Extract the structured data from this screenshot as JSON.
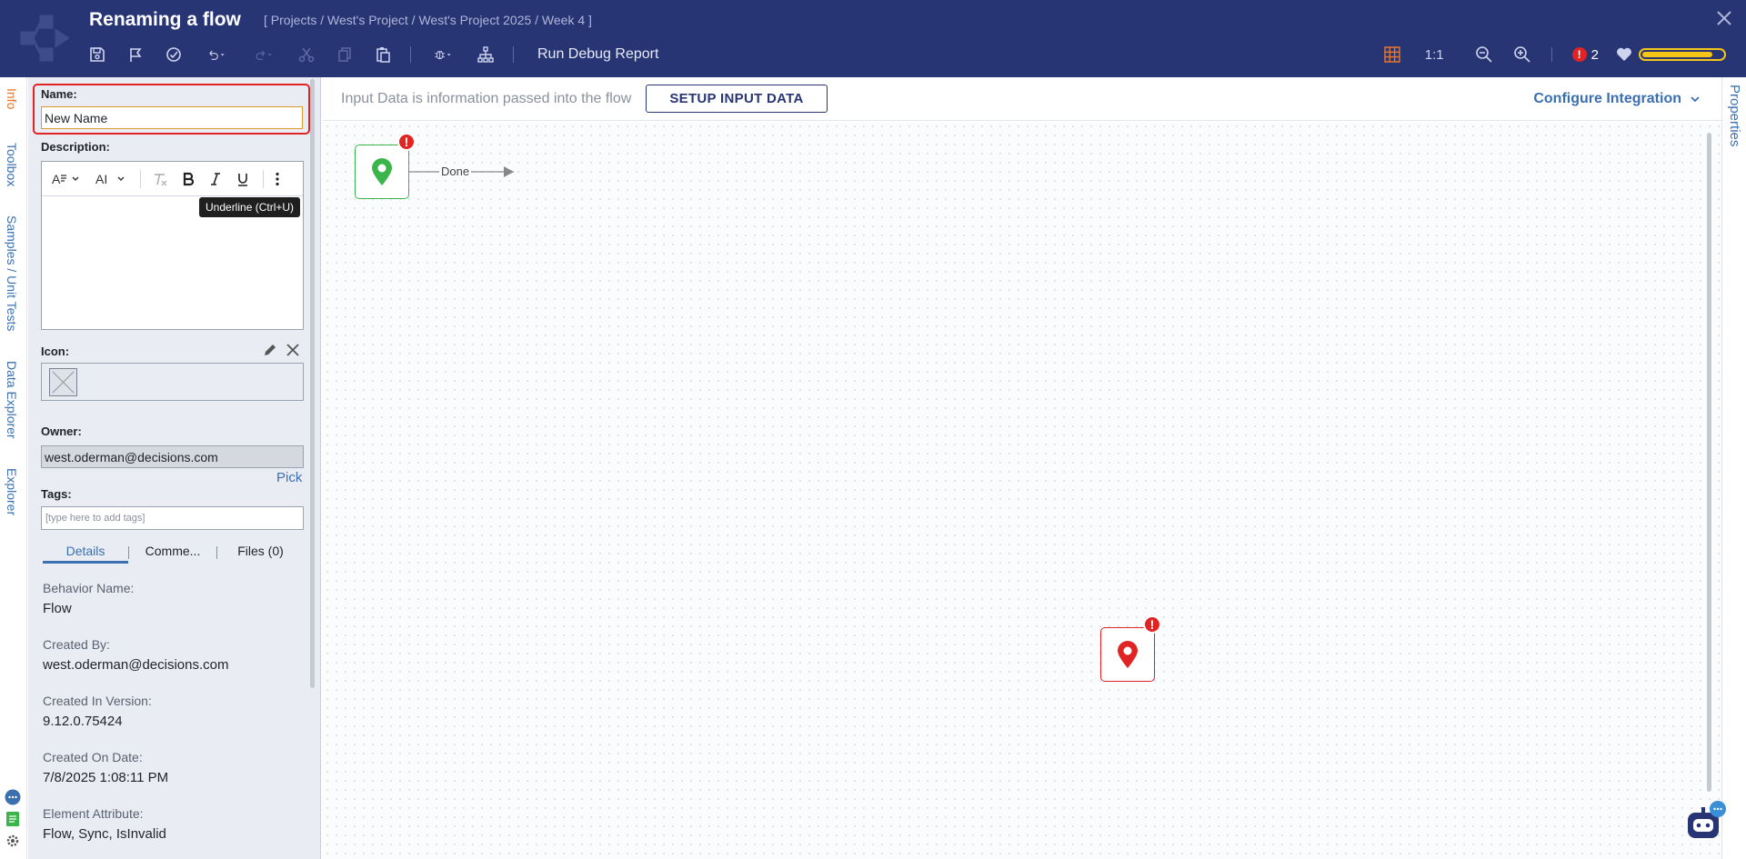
{
  "app": {
    "title": "Renaming a flow",
    "breadcrumb": "[ Projects / West's Project / West's Project 2025 / Week 4 ]"
  },
  "toolbar": {
    "run_debug_label": "Run Debug Report",
    "zoom_label": "1:1",
    "error_count": "2",
    "error_glyph": "!",
    "health_percent": 88
  },
  "left_tabs": [
    "Info",
    "Toolbox",
    "Samples / Unit Tests",
    "Data Explorer",
    "Explorer"
  ],
  "info": {
    "name_label": "Name:",
    "name_value": "New Name",
    "description_label": "Description:",
    "rte_tooltip": "Underline (Ctrl+U)",
    "icon_label": "Icon:",
    "owner_label": "Owner:",
    "owner_value": "west.oderman@decisions.com",
    "pick_label": "Pick",
    "tags_label": "Tags:",
    "tags_placeholder": "[type here to add tags]",
    "subtabs": [
      "Details",
      "Comme...",
      "Files (0)"
    ],
    "fields": [
      {
        "label": "Behavior Name:",
        "value": "Flow"
      },
      {
        "label": "Created By:",
        "value": "west.oderman@decisions.com"
      },
      {
        "label": "Created In Version:",
        "value": "9.12.0.75424"
      },
      {
        "label": "Created On Date:",
        "value": "7/8/2025 1:08:11 PM"
      },
      {
        "label": "Element Attribute:",
        "value": "Flow, Sync, IsInvalid"
      }
    ]
  },
  "canvas": {
    "input_info": "Input Data is information passed into the flow",
    "setup_button": "SETUP INPUT DATA",
    "configure_integration": "Configure Integration",
    "done_label": "Done",
    "node_error_glyph": "!"
  },
  "right_tab": "Properties",
  "colors": {
    "header_bg": "#283574",
    "accent_blue": "#3a6fb0",
    "active_orange": "#e8772e",
    "error_red": "#e02424",
    "start_green": "#3ab54a",
    "health_yellow": "#f5c518"
  }
}
